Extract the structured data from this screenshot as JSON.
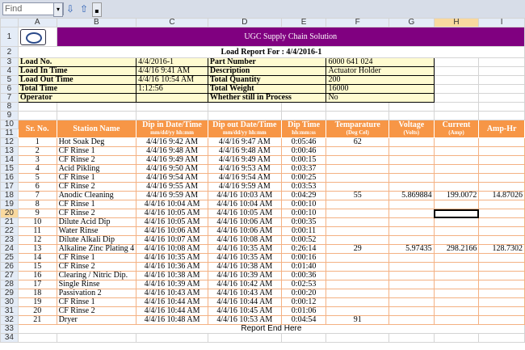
{
  "toolbar": {
    "find_placeholder": "Find",
    "down_icon": "arrow-down-icon",
    "up_icon": "arrow-up-icon"
  },
  "columns": [
    "A",
    "B",
    "C",
    "D",
    "E",
    "F",
    "G",
    "H",
    "I"
  ],
  "selected_column": "H",
  "selected_row": "20",
  "row_numbers": [
    "1",
    "2",
    "3",
    "4",
    "5",
    "6",
    "7",
    "8",
    "9",
    "10",
    "11",
    "12",
    "13",
    "14",
    "15",
    "16",
    "17",
    "18",
    "19",
    "20",
    "21",
    "22",
    "23",
    "24",
    "25",
    "26",
    "27",
    "28",
    "29",
    "30",
    "31",
    "32",
    "33",
    "34"
  ],
  "banner": "UGC Supply Chain Solution",
  "report_title": "Load Report For : 4/4/2016-1",
  "info": [
    [
      "Load No.",
      "4/4/2016-1",
      "Part Number",
      "6000 641 024"
    ],
    [
      "Load In Time",
      "4/4/16 9:41 AM",
      "Description",
      "Actuator Holder"
    ],
    [
      "Load Out Time",
      "4/4/16 10:54 AM",
      "Total Quantity",
      "200"
    ],
    [
      "Total Time",
      "1:12:56",
      "Total Weight",
      "16000"
    ],
    [
      "Operator",
      "",
      "Whether still in Process",
      "No"
    ]
  ],
  "headers": {
    "sr": "Sr. No.",
    "station": "Station Name",
    "dip_in": "Dip in Date/Time",
    "dip_in_unit": "mm/dd/yy hh:mm",
    "dip_out": "Dip out Date/Time",
    "dip_out_unit": "mm/dd/yy hh:mm",
    "dip_time": "Dip Time",
    "dip_time_unit": "hh:mm:ss",
    "temp": "Temparature",
    "temp_unit": "(Deg Cel)",
    "voltage": "Voltage",
    "voltage_unit": "(Volts)",
    "current": "Current",
    "current_unit": "(Amp)",
    "amphr": "Amp-Hr"
  },
  "rows": [
    [
      "1",
      "Hot Soak Deg",
      "4/4/16 9:42 AM",
      "4/4/16 9:47 AM",
      "0:05:46",
      "62",
      "",
      "",
      ""
    ],
    [
      "2",
      "CF Rinse 1",
      "4/4/16 9:48 AM",
      "4/4/16 9:48 AM",
      "0:00:46",
      "",
      "",
      "",
      ""
    ],
    [
      "3",
      "CF Rinse 2",
      "4/4/16 9:49 AM",
      "4/4/16 9:49 AM",
      "0:00:15",
      "",
      "",
      "",
      ""
    ],
    [
      "4",
      "Acid Pikling",
      "4/4/16 9:50 AM",
      "4/4/16 9:53 AM",
      "0:03:37",
      "",
      "",
      "",
      ""
    ],
    [
      "5",
      "CF Rinse 1",
      "4/4/16 9:54 AM",
      "4/4/16 9:54 AM",
      "0:00:25",
      "",
      "",
      "",
      ""
    ],
    [
      "6",
      "CF Rinse 2",
      "4/4/16 9:55 AM",
      "4/4/16 9:59 AM",
      "0:03:53",
      "",
      "",
      "",
      ""
    ],
    [
      "7",
      "Anodic Cleaning",
      "4/4/16 9:59 AM",
      "4/4/16 10:03 AM",
      "0:04:29",
      "55",
      "5.869884",
      "199.0072",
      "14.87026"
    ],
    [
      "8",
      "CF Rinse 1",
      "4/4/16 10:04 AM",
      "4/4/16 10:04 AM",
      "0:00:10",
      "",
      "",
      "",
      ""
    ],
    [
      "9",
      "CF Rinse 2",
      "4/4/16 10:05 AM",
      "4/4/16 10:05 AM",
      "0:00:10",
      "",
      "",
      "",
      ""
    ],
    [
      "10",
      "Dilute Acid Dip",
      "4/4/16 10:05 AM",
      "4/4/16 10:06 AM",
      "0:00:35",
      "",
      "",
      "",
      ""
    ],
    [
      "11",
      "Water Rinse",
      "4/4/16 10:06 AM",
      "4/4/16 10:06 AM",
      "0:00:11",
      "",
      "",
      "",
      ""
    ],
    [
      "12",
      "Dilute Alkali Dip",
      "4/4/16 10:07 AM",
      "4/4/16 10:08 AM",
      "0:00:52",
      "",
      "",
      "",
      ""
    ],
    [
      "13",
      "Alkaline Zinc Plating 4",
      "4/4/16 10:08 AM",
      "4/4/16 10:35 AM",
      "0:26:14",
      "29",
      "5.97435",
      "298.2166",
      "128.7302"
    ],
    [
      "14",
      "CF Rinse 1",
      "4/4/16 10:35 AM",
      "4/4/16 10:35 AM",
      "0:00:16",
      "",
      "",
      "",
      ""
    ],
    [
      "15",
      "CF Rinse 2",
      "4/4/16 10:36 AM",
      "4/4/16 10:38 AM",
      "0:01:40",
      "",
      "",
      "",
      ""
    ],
    [
      "16",
      "Clearing / Nitric Dip.",
      "4/4/16 10:38 AM",
      "4/4/16 10:39 AM",
      "0:00:36",
      "",
      "",
      "",
      ""
    ],
    [
      "17",
      "Single Rinse",
      "4/4/16 10:39 AM",
      "4/4/16 10:42 AM",
      "0:02:53",
      "",
      "",
      "",
      ""
    ],
    [
      "18",
      "Passivation 2",
      "4/4/16 10:43 AM",
      "4/4/16 10:43 AM",
      "0:00:20",
      "",
      "",
      "",
      ""
    ],
    [
      "19",
      "CF Rinse 1",
      "4/4/16 10:44 AM",
      "4/4/16 10:44 AM",
      "0:00:12",
      "",
      "",
      "",
      ""
    ],
    [
      "20",
      "CF Rinse 2",
      "4/4/16 10:44 AM",
      "4/4/16 10:45 AM",
      "0:01:06",
      "",
      "",
      "",
      ""
    ],
    [
      "21",
      "Dryer",
      "4/4/16 10:48 AM",
      "4/4/16 10:53 AM",
      "0:04:54",
      "91",
      "",
      "",
      ""
    ]
  ],
  "footer": "Report End Here"
}
